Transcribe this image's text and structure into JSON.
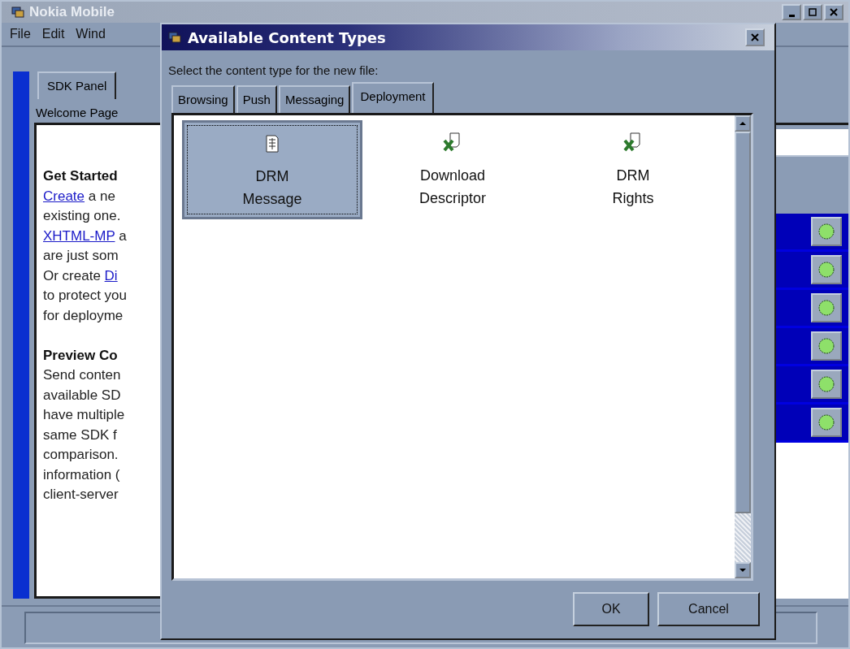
{
  "main_window": {
    "title": "Nokia Mobile",
    "menu": [
      "File",
      "Edit",
      "Wind"
    ],
    "tabs": [
      {
        "label": "SDK Panel"
      }
    ],
    "panel_label": "Welcome Page",
    "welcome_lines": [
      {
        "kind": "heading",
        "text": "Get Started"
      },
      {
        "kind": "text",
        "segments": [
          {
            "text": "Create",
            "link": true
          },
          {
            "text": " a ne",
            "link": false
          }
        ]
      },
      {
        "kind": "text",
        "segments": [
          {
            "text": "existing one.",
            "link": false
          }
        ]
      },
      {
        "kind": "text",
        "segments": [
          {
            "text": "XHTML-MP",
            "link": true
          },
          {
            "text": " a",
            "link": false
          }
        ]
      },
      {
        "kind": "text",
        "segments": [
          {
            "text": "are just som",
            "link": false
          }
        ]
      },
      {
        "kind": "text",
        "segments": [
          {
            "text": "Or create ",
            "link": false
          },
          {
            "text": "Di",
            "link": true
          }
        ]
      },
      {
        "kind": "text",
        "segments": [
          {
            "text": "to protect you",
            "link": false
          }
        ]
      },
      {
        "kind": "text",
        "segments": [
          {
            "text": "for deployme",
            "link": false
          }
        ]
      },
      {
        "kind": "gap"
      },
      {
        "kind": "heading",
        "text": "Preview Co"
      },
      {
        "kind": "text",
        "segments": [
          {
            "text": "Send conten",
            "link": false
          }
        ]
      },
      {
        "kind": "text",
        "segments": [
          {
            "text": "available SD",
            "link": false
          }
        ]
      },
      {
        "kind": "text",
        "segments": [
          {
            "text": "have multiple",
            "link": false
          }
        ]
      },
      {
        "kind": "text",
        "segments": [
          {
            "text": "same SDK f",
            "link": false
          }
        ]
      },
      {
        "kind": "text",
        "segments": [
          {
            "text": "comparison.",
            "link": false
          }
        ]
      },
      {
        "kind": "text",
        "segments": [
          {
            "text": "information (",
            "link": false
          }
        ]
      },
      {
        "kind": "text",
        "segments": [
          {
            "text": "client-server",
            "link": false
          }
        ]
      }
    ],
    "device_rows": [
      {
        "on": true
      },
      {
        "on": true
      },
      {
        "on": true
      },
      {
        "on": true
      },
      {
        "on": true
      },
      {
        "on": true
      }
    ]
  },
  "dialog": {
    "title": "Available Content Types",
    "instruction": "Select the content type for the new file:",
    "tabs": [
      {
        "label": "Browsing",
        "selected": false
      },
      {
        "label": "Push",
        "selected": false
      },
      {
        "label": "Messaging",
        "selected": false
      },
      {
        "label": "Deployment",
        "selected": true
      }
    ],
    "items": [
      {
        "label": "DRM Message",
        "kind": "sheet",
        "selected": true
      },
      {
        "label": "Download Descriptor",
        "kind": "xdoc",
        "selected": false
      },
      {
        "label": "DRM Rights",
        "kind": "xdoc",
        "selected": false
      }
    ],
    "buttons": [
      "OK",
      "Cancel"
    ]
  }
}
